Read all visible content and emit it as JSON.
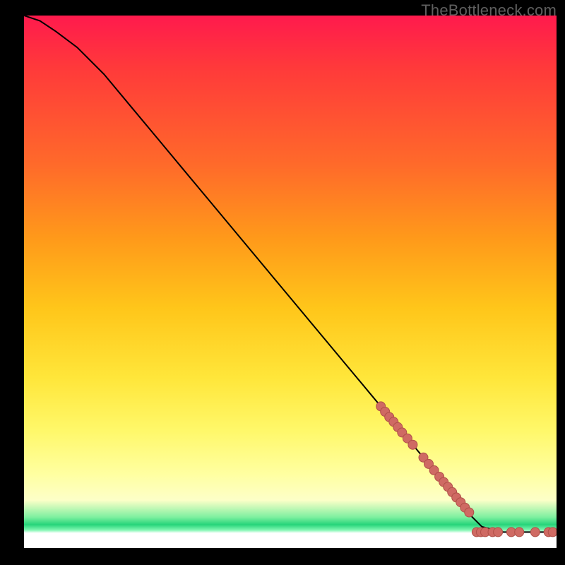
{
  "watermark": "TheBottleneck.com",
  "colors": {
    "curve": "#000000",
    "marker_fill": "#cf6a63",
    "marker_stroke": "#b05048",
    "background_black": "#000000"
  },
  "chart_data": {
    "type": "line",
    "title": "",
    "xlabel": "",
    "ylabel": "",
    "xlim": [
      0,
      100
    ],
    "ylim": [
      0,
      100
    ],
    "grid": false,
    "legend": false,
    "series": [
      {
        "name": "curve",
        "kind": "line",
        "x": [
          0,
          3,
          6,
          10,
          15,
          20,
          25,
          30,
          35,
          40,
          45,
          50,
          55,
          60,
          65,
          70,
          75,
          80,
          83,
          86,
          90,
          94,
          98,
          100
        ],
        "y": [
          100,
          99,
          97,
          94,
          89,
          83,
          77,
          71,
          65,
          59,
          53,
          47,
          41,
          35,
          29,
          23,
          17,
          11,
          7,
          4,
          3,
          3,
          3,
          3
        ]
      },
      {
        "name": "markers-on-slope",
        "kind": "scatter",
        "x": [
          67.0,
          67.8,
          68.6,
          69.4,
          70.2,
          71.0,
          72.0,
          73.0,
          75.0,
          76.0,
          77.0,
          78.0,
          78.8,
          79.6,
          80.4,
          81.2,
          82.0,
          82.8,
          83.6
        ],
        "y": [
          26.6,
          25.6,
          24.6,
          23.7,
          22.7,
          21.7,
          20.6,
          19.4,
          17.0,
          15.8,
          14.6,
          13.4,
          12.4,
          11.5,
          10.5,
          9.5,
          8.6,
          7.6,
          6.7
        ]
      },
      {
        "name": "markers-flat",
        "kind": "scatter",
        "x": [
          85.0,
          85.8,
          86.6,
          88.0,
          89.0,
          91.5,
          93.0,
          96.0,
          98.5,
          99.3
        ],
        "y": [
          3.0,
          3.0,
          3.0,
          3.0,
          3.0,
          3.0,
          3.0,
          3.0,
          3.0,
          3.0
        ]
      }
    ]
  }
}
